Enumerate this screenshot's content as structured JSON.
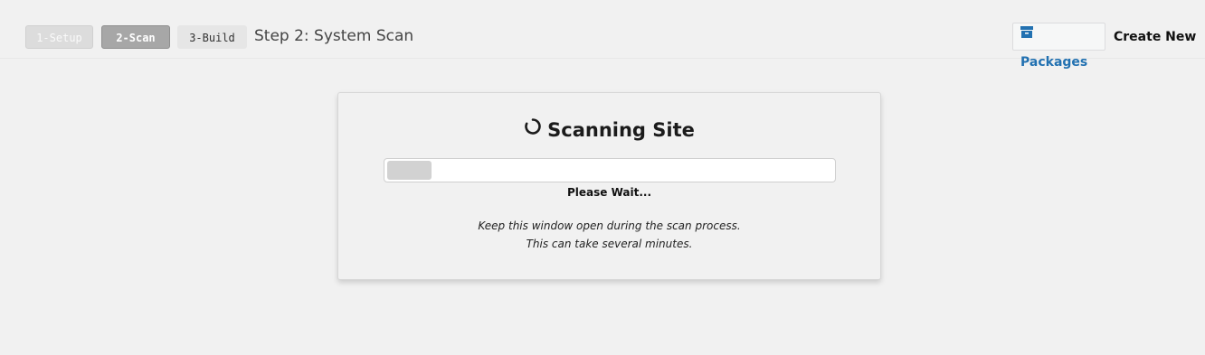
{
  "steps": [
    {
      "label": "1-Setup",
      "state": "disabled"
    },
    {
      "label": "2-Scan",
      "state": "active"
    },
    {
      "label": "3-Build",
      "state": "pending"
    }
  ],
  "step_title": "Step 2: System Scan",
  "toolbar": {
    "packages_label": "Packages",
    "packages_icon": "archive-icon",
    "create_new_label": "Create New"
  },
  "scan": {
    "title": "Scanning Site",
    "title_icon": "spinner-icon",
    "progress_fraction": 0.1,
    "status": "Please Wait...",
    "notice_line1": "Keep this window open during the scan process.",
    "notice_line2": "This can take several minutes."
  },
  "colors": {
    "accent": "#2271b1",
    "background": "#f1f1f1",
    "active_step": "#a7a7a7"
  }
}
